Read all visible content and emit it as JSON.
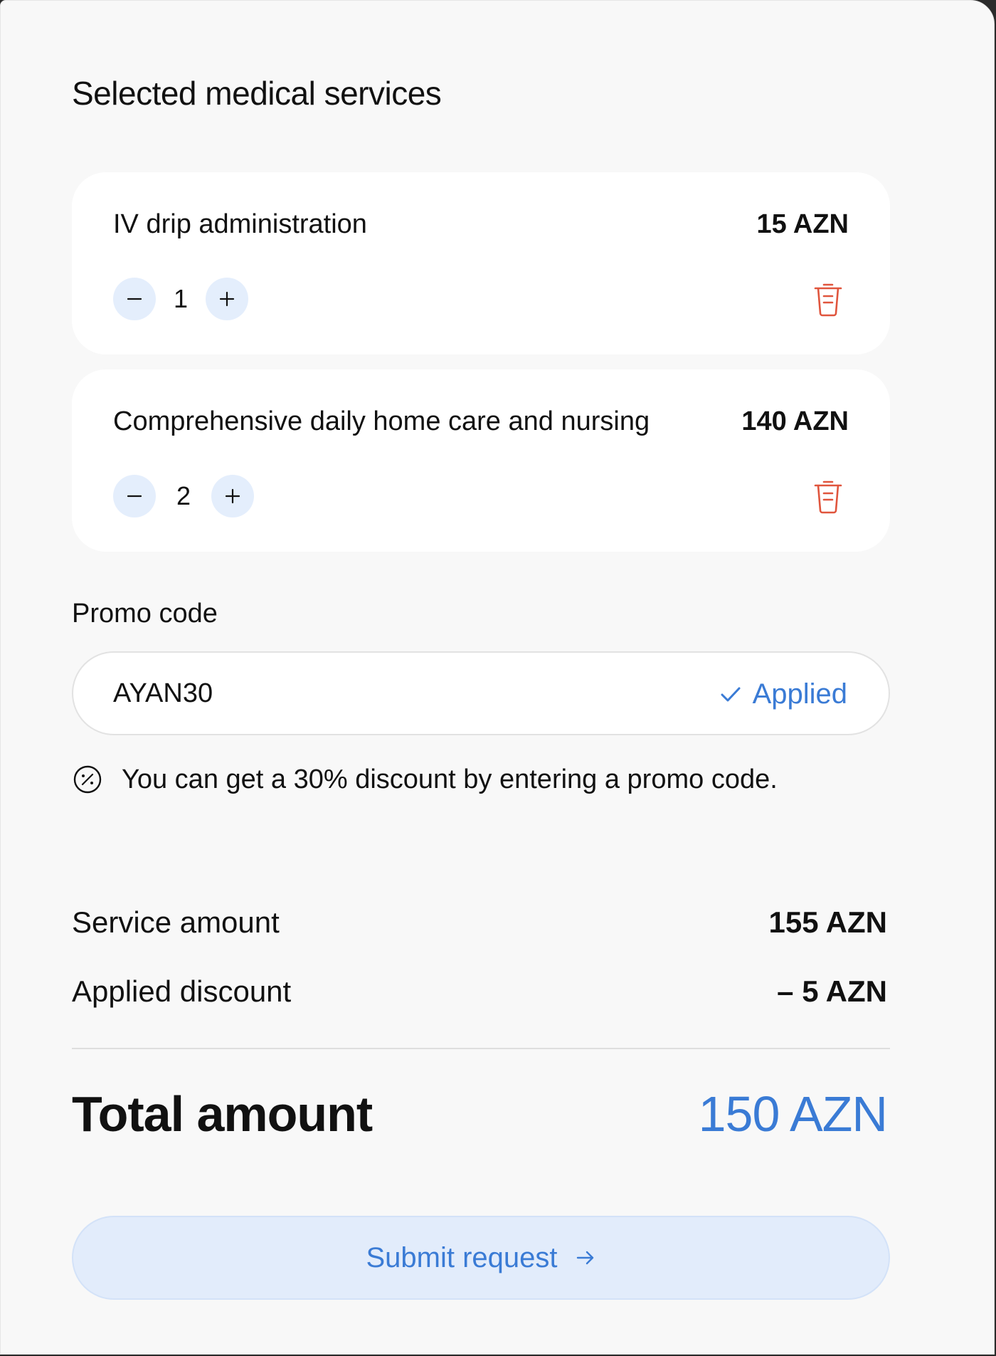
{
  "title": "Selected medical services",
  "services": [
    {
      "name": "IV drip administration",
      "price": "15 AZN",
      "quantity": "1"
    },
    {
      "name": "Comprehensive daily home care and nursing",
      "price": "140 AZN",
      "quantity": "2"
    }
  ],
  "promo": {
    "label": "Promo code",
    "value": "AYAN30",
    "status": "Applied",
    "hint": "You can get a 30% discount by entering a promo code."
  },
  "summary": {
    "service_amount_label": "Service amount",
    "service_amount_value": "155 AZN",
    "discount_label": "Applied discount",
    "discount_value": "– 5 AZN",
    "total_label": "Total amount",
    "total_value": "150 AZN"
  },
  "submit": {
    "label": "Submit request"
  },
  "icons": {
    "minus": "minus-icon",
    "plus": "plus-icon",
    "delete": "trash-icon",
    "check": "check-icon",
    "discount": "percent-icon",
    "arrow": "arrow-right-icon"
  },
  "colors": {
    "accent": "#3a7bd5",
    "delete": "#e0553d",
    "qty_button_bg": "#e4eefc",
    "background": "#f8f8f8"
  }
}
